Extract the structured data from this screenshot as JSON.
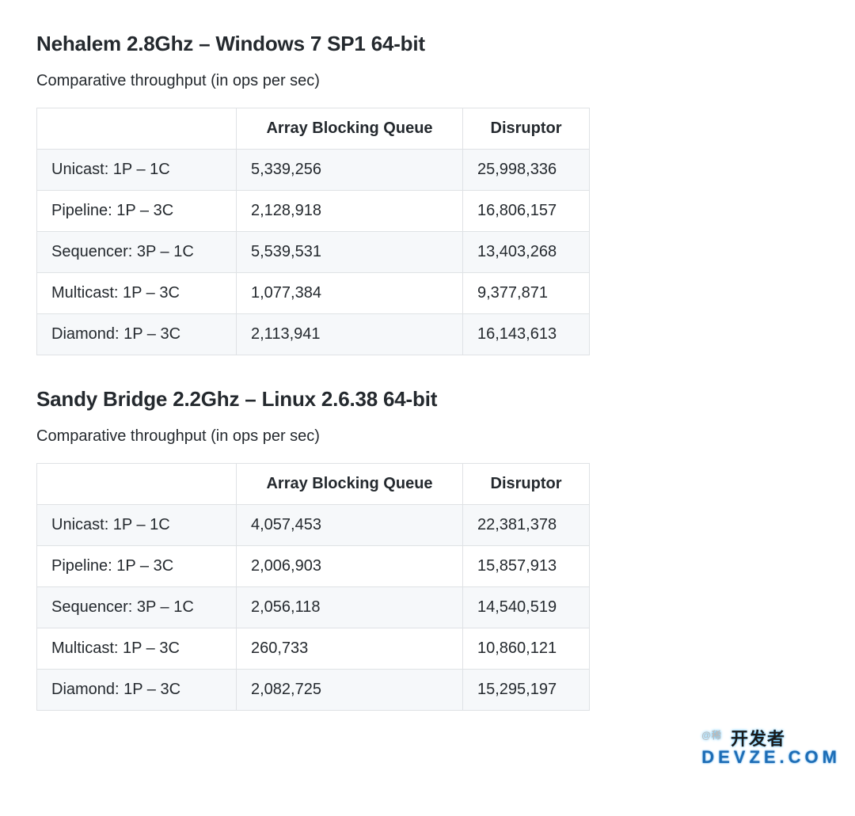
{
  "sections": [
    {
      "title": "Nehalem 2.8Ghz – Windows 7 SP1 64-bit",
      "subtitle": "Comparative throughput (in ops per sec)",
      "headers": [
        "",
        "Array Blocking Queue",
        "Disruptor"
      ],
      "rows": [
        [
          "Unicast: 1P – 1C",
          "5,339,256",
          "25,998,336"
        ],
        [
          "Pipeline: 1P – 3C",
          "2,128,918",
          "16,806,157"
        ],
        [
          "Sequencer: 3P – 1C",
          "5,539,531",
          "13,403,268"
        ],
        [
          "Multicast: 1P – 3C",
          "1,077,384",
          "9,377,871"
        ],
        [
          "Diamond: 1P – 3C",
          "2,113,941",
          "16,143,613"
        ]
      ]
    },
    {
      "title": "Sandy Bridge 2.2Ghz – Linux 2.6.38 64-bit",
      "subtitle": "Comparative throughput (in ops per sec)",
      "headers": [
        "",
        "Array Blocking Queue",
        "Disruptor"
      ],
      "rows": [
        [
          "Unicast: 1P – 1C",
          "4,057,453",
          "22,381,378"
        ],
        [
          "Pipeline: 1P – 3C",
          "2,006,903",
          "15,857,913"
        ],
        [
          "Sequencer: 3P – 1C",
          "2,056,118",
          "14,540,519"
        ],
        [
          "Multicast: 1P – 3C",
          "260,733",
          "10,860,121"
        ],
        [
          "Diamond: 1P – 3C",
          "2,082,725",
          "15,295,197"
        ]
      ]
    }
  ],
  "watermark": {
    "prefix": "@稀",
    "line1": "开发者",
    "line2": "DEVZE.COM"
  }
}
